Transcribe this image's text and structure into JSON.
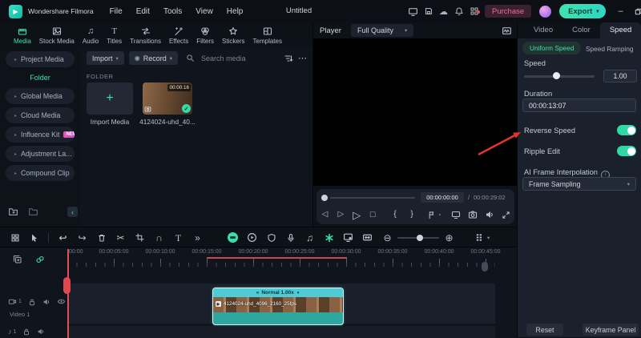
{
  "icons": {
    "chevron_down": "▾",
    "chevron_right": "▸",
    "collapse_left": "‹",
    "ellipsis": "⋯",
    "record_dot": "◉",
    "plus": "+",
    "check": "✓",
    "scissors": "✂",
    "undo": "↩",
    "redo": "↪",
    "text_tool": "T",
    "more_tools": "»",
    "magnet": "∩",
    "music_note": "♫",
    "music_note_small": "♪",
    "zoom_out": "⊖",
    "zoom_in": "⊕",
    "play": "▷",
    "stop": "□",
    "step_back": "◁",
    "step_forward": "▷",
    "brace_in": "{",
    "brace_out": "}",
    "cloud": "☁",
    "reverse_marks": "«",
    "clip_chevron": "▼",
    "minimize": "–",
    "close": "×",
    "info": "i",
    "logo_play": "▶"
  },
  "colors": {
    "accent_teal": "#3fe0ae",
    "purchase_pink": "#ef6e96",
    "playhead_red": "#e0484f",
    "clip_teal": "#4fcbd7"
  },
  "titlebar": {
    "app_name": "Wondershare Filmora",
    "menus": [
      "File",
      "Edit",
      "Tools",
      "View",
      "Help"
    ],
    "project_title": "Untitled",
    "purchase_label": "Purchase",
    "export_label": "Export"
  },
  "media_tabs": [
    "Media",
    "Stock Media",
    "Audio",
    "Titles",
    "Transitions",
    "Effects",
    "Filters",
    "Stickers",
    "Templates"
  ],
  "sidebar": {
    "items": [
      "Project Media",
      "Global Media",
      "Cloud Media",
      "Influence Kit",
      "Adjustment La...",
      "Compound Clip"
    ],
    "selected_item": "Folder",
    "new_badge": "NEW"
  },
  "media_panel": {
    "import_button": "Import",
    "record_button": "Record",
    "search_placeholder": "Search media",
    "section_label": "FOLDER",
    "import_tile_label": "Import Media",
    "clip_name": "4124024-uhd_40...",
    "clip_duration": "00:00:16"
  },
  "player": {
    "label": "Player",
    "quality": "Full Quality",
    "current_time": "00:00:00:00",
    "separator": "/",
    "total_time": "00:00:29:02"
  },
  "properties": {
    "tabs": [
      "Video",
      "Color",
      "Speed"
    ],
    "active_tab": "Speed",
    "sub_tabs": [
      "Uniform Speed",
      "Speed Ramping"
    ],
    "speed_label": "Speed",
    "speed_value": "1.00",
    "duration_label": "Duration",
    "duration_value": "00:00:13:07",
    "reverse_speed_label": "Reverse Speed",
    "reverse_speed_on": true,
    "ripple_edit_label": "Ripple Edit",
    "ripple_edit_on": true,
    "ai_interpolation_label": "AI Frame Interpolation",
    "ai_interpolation_value": "Frame Sampling",
    "reset_button": "Reset",
    "keyframe_button": "Keyframe Panel"
  },
  "timeline": {
    "ruler_labels": [
      "00:00",
      "00:00:05:00",
      "00:00:10:00",
      "00:00:15:00",
      "00:00:20:00",
      "00:00:25:00",
      "00:00:30:00",
      "00:00:35:00",
      "00:00:40:00",
      "00:00:45:00"
    ],
    "video_track_label": "Video 1",
    "video_track_number": "1",
    "audio_track_number": "1",
    "clip_speed_badge": "Normal 1.00x",
    "clip_name": "4124024-uhd_4096_2160_25fps"
  }
}
